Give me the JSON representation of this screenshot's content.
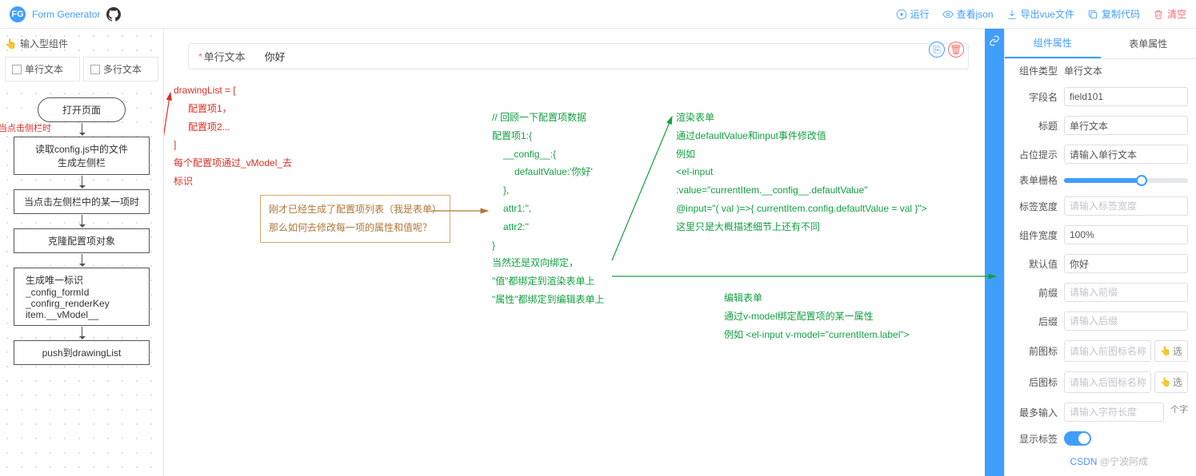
{
  "header": {
    "brand": "Form Generator",
    "actions": {
      "run": "运行",
      "view_json": "查看json",
      "export_vue": "导出vue文件",
      "copy_code": "复制代码",
      "clear": "清空"
    }
  },
  "left_rail": {
    "group_title": "输入型组件",
    "components": [
      "单行文本",
      "多行文本"
    ],
    "side_note": "当点击侧栏时",
    "flow": {
      "n1": "打开页面",
      "n2_line1": "读取config.js中的文件",
      "n2_line2": "生成左侧栏",
      "n3": "当点击左侧栏中的某一项时",
      "n4": "克隆配置项对象",
      "n5_line1": "生成唯一标识",
      "n5_line2": "_config_formId",
      "n5_line3": "_confirg_renderKey",
      "n5_line4": "item.__vModel__",
      "n6": "push到drawingList"
    }
  },
  "canvas": {
    "field_label": "单行文本",
    "field_value": "你好"
  },
  "annotations": {
    "red_block": {
      "l1": "drawingList = [",
      "l2": "配置项1，",
      "l3": "配置项2...",
      "l4": "]",
      "l5": "每个配置项通过_vModel_去",
      "l6": "标识"
    },
    "saddle_box": {
      "l1": "刚才已经生成了配置项列表（我是表单）",
      "l2": "那么如何去修改每一项的属性和值呢？"
    },
    "green_mid": {
      "l1": "// 回顾一下配置项数据",
      "l2": "配置项1:{",
      "l3": "__config__:{",
      "l4": "defaultValue:'你好'",
      "l5": "},",
      "l6": "attr1:'',",
      "l7": "attr2:''",
      "l8": "}",
      "l9": "当然还是双向绑定，",
      "l10": "\"值\"都绑定到渲染表单上",
      "l11": "\"属性\"都绑定到编辑表单上"
    },
    "green_right_top": {
      "l1": "渲染表单",
      "l2": "通过defaultValue和input事件修改值",
      "l3": "例如",
      "l4": "<el-input",
      "l5": ":value=\"currentItem.__config__.defaultValue\"",
      "l6": "@input=\"( val )=>{ currentItem.config.defaultValue = val }\">",
      "l7": "这里只是大概描述细节上还有不同"
    },
    "green_right_bottom": {
      "l1": "编辑表单",
      "l2": "通过v-model绑定配置项的某一属性",
      "l3": "例如 <el-input v-model=\"currentItem.label\">"
    }
  },
  "right_panel": {
    "tabs": {
      "component": "组件属性",
      "form": "表单属性"
    },
    "rows": {
      "type_label": "组件类型",
      "type_value": "单行文本",
      "field_label": "字段名",
      "field_value": "field101",
      "title_label": "标题",
      "title_value": "单行文本",
      "placeholder_label": "占位提示",
      "placeholder_value": "请输入单行文本",
      "grid_label": "表单栅格",
      "label_width_label": "标签宽度",
      "label_width_ph": "请输入标签宽度",
      "comp_width_label": "组件宽度",
      "comp_width_value": "100%",
      "default_label": "默认值",
      "default_value": "你好",
      "prefix_label": "前缀",
      "prefix_ph": "请输入前缀",
      "suffix_label": "后缀",
      "suffix_ph": "请输入后缀",
      "prefix_icon_label": "前图标",
      "prefix_icon_ph": "请输入前图标名称",
      "icon_btn": "选",
      "suffix_icon_label": "后图标",
      "suffix_icon_ph": "请输入后图标名称",
      "maxlen_label": "最多输入",
      "maxlen_ph": "请输入字符长度",
      "maxlen_unit": "个字",
      "show_label_label": "显示标签"
    }
  },
  "watermark": {
    "a": "CSDN",
    "b": " @宁波阿成"
  }
}
